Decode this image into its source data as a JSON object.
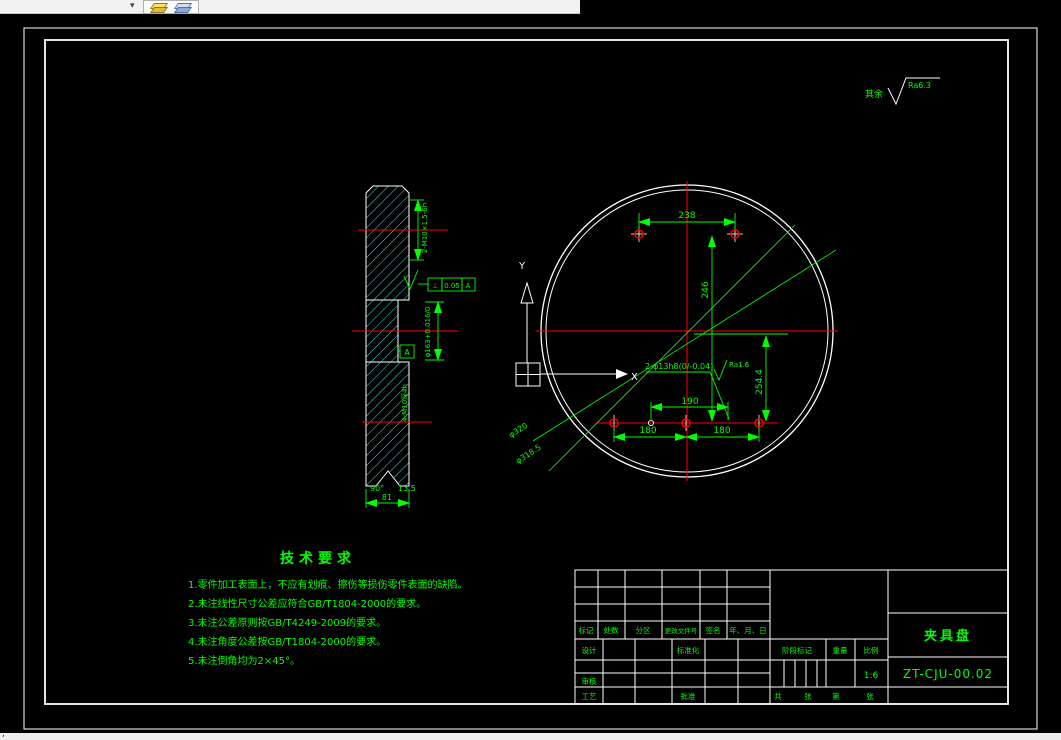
{
  "toolbar": {
    "dropdown": "▾"
  },
  "statusbar": {
    "prompt": ","
  },
  "surface_note": {
    "prefix": "其余",
    "value": "Ra6.3"
  },
  "section_view": {
    "thread_note": "2-M10×1.5-6h",
    "bore_note": "φ163+0.016/0",
    "thread_note2": "4-M10深4h",
    "tol_symbol": "⊥",
    "tol_value": "0.05",
    "tol_datum": "A",
    "datum_label": "A",
    "angle": "90°",
    "chamfer": "13.5",
    "width": "81"
  },
  "circle_view": {
    "dim_top": "238",
    "dim_height": "246",
    "dim_right": "254.4",
    "dim_mid": "190",
    "dim_bot_left": "180",
    "dim_bot_right": "180",
    "hole_note": "2-φ13h8(0/-0.04)",
    "hole_roughness": "Ra1.6",
    "dia_outer": "φ320",
    "dia_inner": "φ318.5",
    "axis_x": "X",
    "axis_y": "Y"
  },
  "tech_req": {
    "title": "技术要求",
    "items": [
      "1.零件加工表面上，不应有划痕、擦伤等损伤零件表面的缺陷。",
      "2.未注线性尺寸公差应符合GB/T1804-2000的要求。",
      "3.未注公差原则按GB/T4249-2009的要求。",
      "4.未注角度公差按GB/T1804-2000的要求。",
      "5.未注倒角均为2×45°。"
    ]
  },
  "title_block": {
    "headers": [
      "标记",
      "处数",
      "分区",
      "更改文件号",
      "签名",
      "年、月、日"
    ],
    "design": "设计",
    "standardization": "标准化",
    "review": "审核",
    "process": "工艺",
    "approve": "批准",
    "stage_mark": "阶段标记",
    "weight": "重量",
    "scale_label": "比例",
    "scale_value": "1:6",
    "total_label": "共",
    "sheet_label": "张",
    "page_label": "第",
    "page_label2": "张",
    "part_name": "夹具盘",
    "drawing_no": "ZT-CJU-00.02"
  },
  "colors": {
    "background": "#000000",
    "lines": "#ffffff",
    "dimensions": "#00ff00",
    "centerlines": "#ff0000",
    "hatch": "#40e0e0"
  }
}
